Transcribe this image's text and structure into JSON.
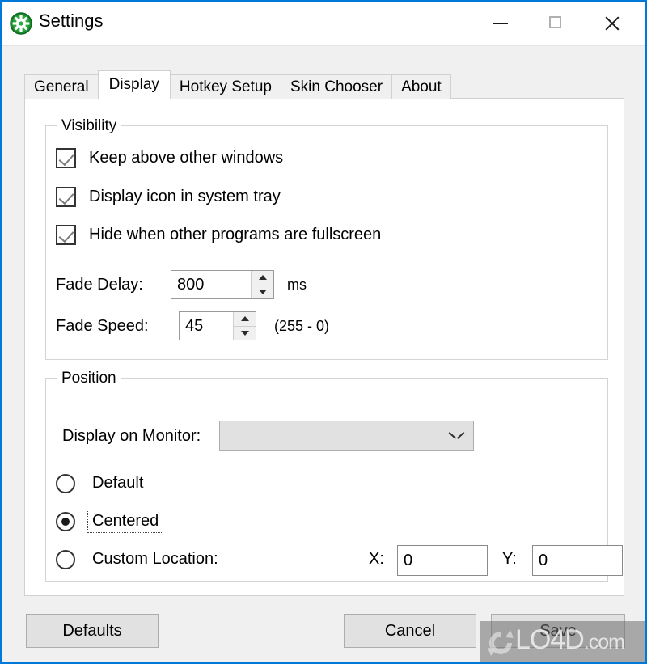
{
  "window": {
    "title": "Settings",
    "icon": "gear-icon",
    "accent_color": "#0078d7",
    "titlebar_background": "#ffffff",
    "body_background": "#f0f0f0",
    "controls": {
      "minimize": "minimize-icon",
      "maximize": "maximize-icon",
      "close": "close-icon"
    }
  },
  "tabs": [
    {
      "label": "General",
      "selected": false
    },
    {
      "label": "Display",
      "selected": true
    },
    {
      "label": "Hotkey Setup",
      "selected": false
    },
    {
      "label": "Skin Chooser",
      "selected": false
    },
    {
      "label": "About",
      "selected": false
    }
  ],
  "visibility": {
    "legend": "Visibility",
    "checkboxes": [
      {
        "label": "Keep above other windows",
        "checked": true
      },
      {
        "label": "Display icon in system tray",
        "checked": true
      },
      {
        "label": "Hide when other programs are fullscreen",
        "checked": true
      }
    ],
    "fade_delay": {
      "label": "Fade Delay:",
      "value": "800",
      "suffix": "ms"
    },
    "fade_speed": {
      "label": "Fade Speed:",
      "value": "45",
      "suffix": "(255 - 0)"
    }
  },
  "position": {
    "legend": "Position",
    "monitor": {
      "label": "Display on Monitor:",
      "value": "",
      "chevron": "chevron-down-icon"
    },
    "radios": [
      {
        "label": "Default",
        "selected": false,
        "focused": false
      },
      {
        "label": "Centered",
        "selected": true,
        "focused": true
      },
      {
        "label": "Custom Location:",
        "selected": false,
        "focused": false
      }
    ],
    "custom": {
      "x_label": "X:",
      "x_value": "0",
      "y_label": "Y:",
      "y_value": "0"
    }
  },
  "buttons": {
    "defaults": "Defaults",
    "cancel": "Cancel",
    "save": "Save"
  },
  "watermark": {
    "text": "LO4D",
    "suffix": ".com",
    "logo": "circular-arrow-logo"
  }
}
